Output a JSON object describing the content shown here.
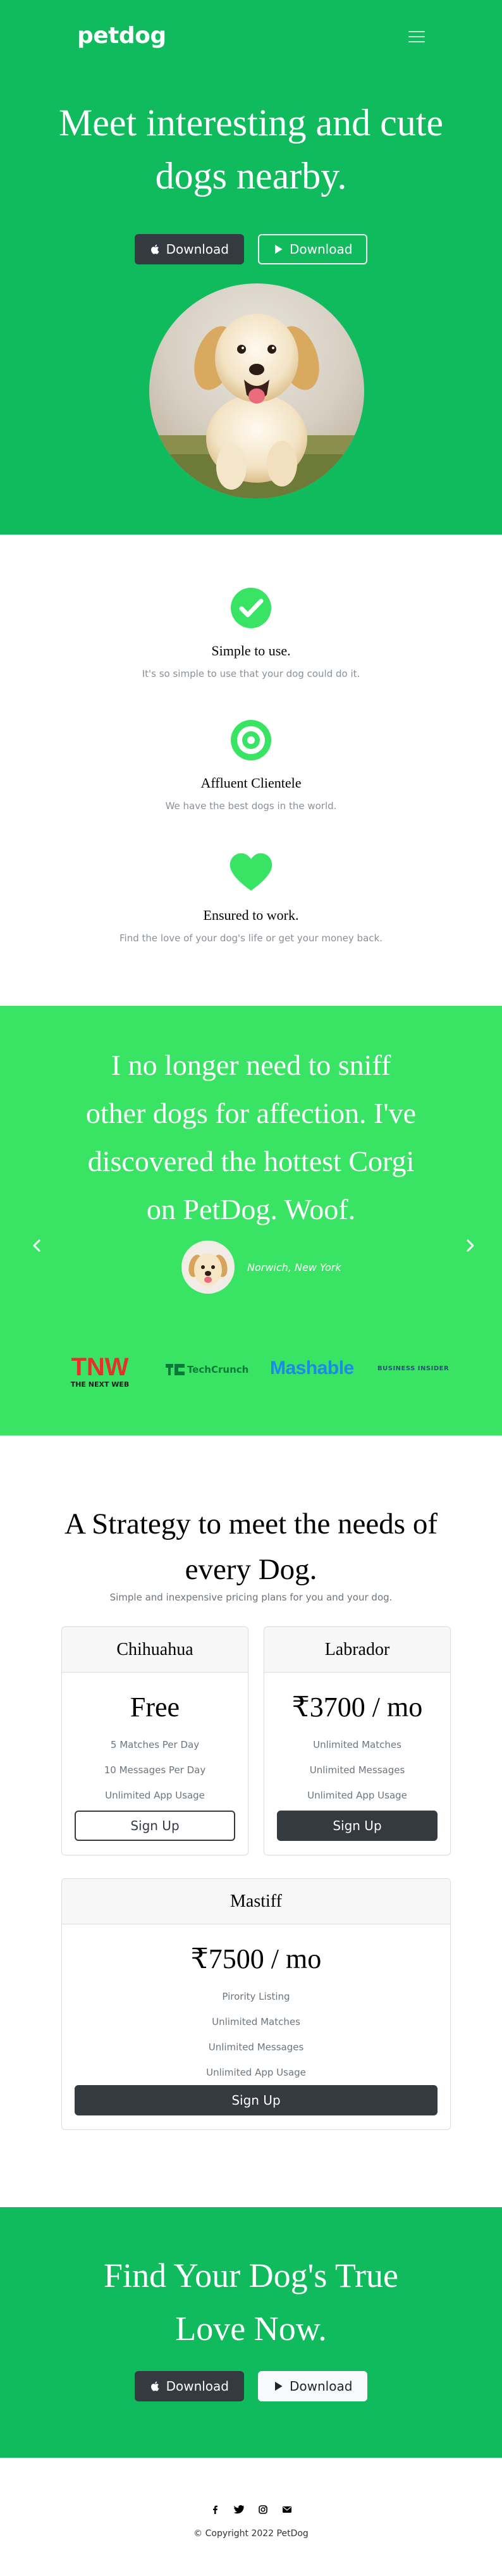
{
  "nav": {
    "brand": "petdog",
    "menu_icon": "hamburger-icon"
  },
  "hero": {
    "title_line1": "Meet interesting and cute",
    "title_line2": "dogs nearby.",
    "apple_download": "Download",
    "play_download": "Download",
    "image": "golden-retriever-puppy-photo"
  },
  "features": [
    {
      "icon": "check-circle-icon",
      "title": "Simple to use.",
      "text": "It's so simple to use that your dog could do it."
    },
    {
      "icon": "bullseye-icon",
      "title": "Affluent Clientele",
      "text": "We have the best dogs in the world."
    },
    {
      "icon": "heart-icon",
      "title": "Ensured to work.",
      "text": "Find the love of your dog's life or get your money back."
    }
  ],
  "testimonial": {
    "line1": "I no longer need to sniff",
    "line2": "other dogs for affection. I've",
    "line3": "discovered the hottest Corgi",
    "line4": "on PetDog. Woof.",
    "author_location": "Norwich, New York"
  },
  "press": {
    "tnw": "TNW",
    "tnw_sub": "THE NEXT WEB",
    "techcrunch": "TechCrunch",
    "mashable": "Mashable",
    "business_insider": "BUSINESS INSIDER"
  },
  "pricing": {
    "title_line1": "A Strategy to meet the needs of",
    "title_line2": "every Dog.",
    "subtitle": "Simple and inexpensive pricing plans for you and your dog.",
    "plans": [
      {
        "name": "Chihuahua",
        "price": "Free",
        "features": [
          "5 Matches Per Day",
          "10 Messages Per Day",
          "Unlimited App Usage"
        ],
        "button": "Sign Up"
      },
      {
        "name": "Labrador",
        "price": "₹3700 / mo",
        "features": [
          "Unlimited Matches",
          "Unlimited Messages",
          "Unlimited App Usage"
        ],
        "button": "Sign Up"
      },
      {
        "name": "Mastiff",
        "price": "₹7500 / mo",
        "features": [
          "Pirority Listing",
          "Unlimited Matches",
          "Unlimited Messages",
          "Unlimited App Usage"
        ],
        "button": "Sign Up"
      }
    ]
  },
  "cta": {
    "title_line1": "Find Your Dog's True",
    "title_line2": "Love Now.",
    "apple_download": "Download",
    "play_download": "Download"
  },
  "footer": {
    "social": [
      "facebook-icon",
      "twitter-icon",
      "instagram-icon",
      "envelope-icon"
    ],
    "copyright": "© Copyright 2022 PetDog"
  },
  "colors": {
    "hero_green": "#0fbb5d",
    "testimonial_green": "#39e465",
    "feature_icon": "#39e465",
    "dark_button": "#343a40"
  }
}
